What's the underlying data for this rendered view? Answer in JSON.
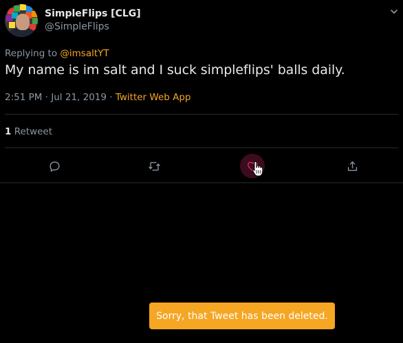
{
  "tweet": {
    "author": {
      "display_name": "SimpleFlips [CLG]",
      "handle": "@SimpleFlips"
    },
    "replying_prefix": "Replying to ",
    "replying_to": "@imsaltYT",
    "text": "My name is im salt and I suck simpleflips' balls daily.",
    "timestamp": "2:51 PM · Jul 21, 2019 · ",
    "source_app": "Twitter Web App",
    "retweet_count": "1",
    "retweet_label": "Retweet"
  },
  "actions": [
    {
      "name": "reply",
      "icon": "reply-icon"
    },
    {
      "name": "retweet",
      "icon": "retweet-icon"
    },
    {
      "name": "like",
      "icon": "heart-icon",
      "state": "hovered"
    },
    {
      "name": "share",
      "icon": "share-icon"
    }
  ],
  "toast": {
    "message": "Sorry, that Tweet has been deleted."
  },
  "colors": {
    "background": "#000000",
    "accent": "#f5a623",
    "like": "#e0245e",
    "muted": "#8b98a5"
  }
}
